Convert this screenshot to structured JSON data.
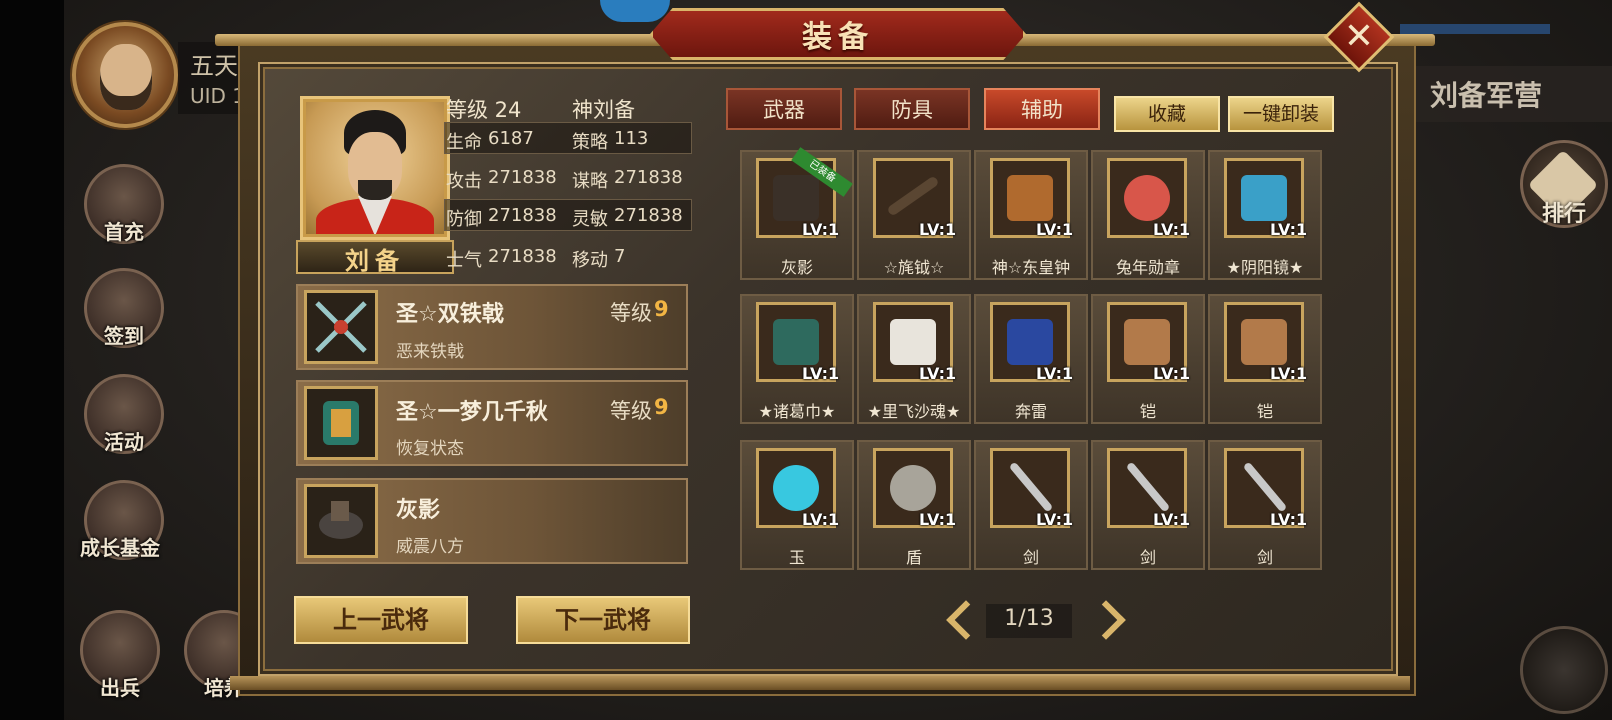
{
  "title": "装备",
  "close_label": "✕",
  "player": {
    "name": "五天",
    "uid": "UID 1"
  },
  "side_menu": [
    "首充",
    "签到",
    "活动",
    "成长基金",
    "出兵",
    "培养"
  ],
  "right_panel": {
    "camp": "刘备军营",
    "rank": "排行"
  },
  "hero": {
    "name": "刘备",
    "level_label": "等级 24",
    "title": "神刘备",
    "stats": [
      {
        "label": "生命",
        "value": "6187"
      },
      {
        "label": "策略",
        "value": "113"
      },
      {
        "label": "攻击",
        "value": "271838"
      },
      {
        "label": "谋略",
        "value": "271838"
      },
      {
        "label": "防御",
        "value": "271838"
      },
      {
        "label": "灵敏",
        "value": "271838"
      },
      {
        "label": "士气",
        "value": "271838"
      },
      {
        "label": "移动",
        "value": "7"
      }
    ]
  },
  "equipped": [
    {
      "name": "圣☆双铁戟",
      "sub": "恶来铁戟",
      "level_label": "等级",
      "level": "9",
      "icon": "dual-halberd-icon"
    },
    {
      "name": "圣☆一梦几千秋",
      "sub": "恢复状态",
      "level_label": "等级",
      "level": "9",
      "icon": "armor-icon"
    },
    {
      "name": "灰影",
      "sub": "威震八方",
      "level_label": "",
      "level": "",
      "icon": "horse-icon"
    }
  ],
  "nav": {
    "prev": "上一武将",
    "next": "下一武将"
  },
  "tabs": [
    "武器",
    "防具",
    "辅助"
  ],
  "actions": {
    "collect": "收藏",
    "unequip_all": "一键卸装"
  },
  "equipped_tag": "已装备",
  "items": [
    {
      "name": "灰影",
      "lv": "LV:1",
      "icon": "horse-icon",
      "color": "#3a3028"
    },
    {
      "name": "☆旄钺☆",
      "lv": "LV:1",
      "icon": "axe-icon",
      "color": "#5a4632"
    },
    {
      "name": "神☆东皇钟",
      "lv": "LV:1",
      "icon": "bell-icon",
      "color": "#b06a2e"
    },
    {
      "name": "兔年勋章",
      "lv": "LV:1",
      "icon": "medal-icon",
      "color": "#d8564a"
    },
    {
      "name": "★阴阳镜★",
      "lv": "LV:1",
      "icon": "mirror-icon",
      "color": "#3aa0c8"
    },
    {
      "name": "★诸葛巾★",
      "lv": "LV:1",
      "icon": "helmet-icon",
      "color": "#2e6a5e"
    },
    {
      "name": "★里飞沙魂★",
      "lv": "LV:1",
      "icon": "white-horse-icon",
      "color": "#e8e4dc"
    },
    {
      "name": "奔雷",
      "lv": "LV:1",
      "icon": "blue-horse-icon",
      "color": "#2a48a0"
    },
    {
      "name": "铠",
      "lv": "LV:1",
      "icon": "saddle-icon",
      "color": "#b27a4a"
    },
    {
      "name": "铠",
      "lv": "LV:1",
      "icon": "saddle-icon",
      "color": "#b27a4a"
    },
    {
      "name": "玉",
      "lv": "LV:1",
      "icon": "jade-icon",
      "color": "#38c8e0"
    },
    {
      "name": "盾",
      "lv": "LV:1",
      "icon": "shield-icon",
      "color": "#a8a49a"
    },
    {
      "name": "剑",
      "lv": "LV:1",
      "icon": "sword-icon",
      "color": "#c8c8c8"
    },
    {
      "name": "剑",
      "lv": "LV:1",
      "icon": "sword-icon",
      "color": "#c8c8c8"
    },
    {
      "name": "剑",
      "lv": "LV:1",
      "icon": "sword-icon",
      "color": "#c8c8c8"
    }
  ],
  "pagination": {
    "text": "1/13"
  }
}
